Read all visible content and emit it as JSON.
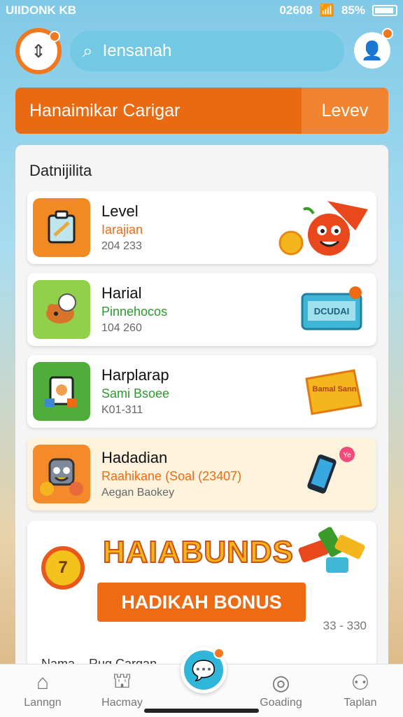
{
  "status": {
    "left": "UIIDONK KB",
    "time": "02608",
    "battery": "85%"
  },
  "search": {
    "placeholder": "Iensanah"
  },
  "banner": {
    "title": "Hanaimikar Carigar",
    "level_label": "Levev"
  },
  "panel": {
    "title": "Datnijilita"
  },
  "cards": [
    {
      "name": "Level",
      "sub": "Iarajian",
      "meta": "204 233",
      "sub_color": "#f06a14",
      "thumb_color": "#f28a24",
      "icon": "clipboard-icon",
      "art": "tomato-mascot"
    },
    {
      "name": "Harial",
      "sub": "Pinnehocos",
      "meta": "104 260",
      "sub_color": "#2b9a2b",
      "thumb_color": "#92cf4a",
      "icon": "bear-icon",
      "art": "ticket"
    },
    {
      "name": "Harplarap",
      "sub": "Sami Bsoee",
      "meta": "K01-311",
      "sub_color": "#2b9a2b",
      "thumb_color": "#4fae3a",
      "icon": "puzzle-icon",
      "art": "bamal-sann-tag"
    },
    {
      "name": "Hadadian",
      "sub": "Raahikane (Soal (23407)",
      "meta": "Aegan Baokey",
      "sub_color": "#f06a14",
      "thumb_color": "#f48a2a",
      "icon": "robot-icon",
      "art": "phone"
    }
  ],
  "card_art": {
    "ticket_text": "DCUDAI",
    "tag_text": "Bamal Sann",
    "phone_badge": "Ye"
  },
  "bonus": {
    "coin": "7",
    "headline": "HAIABUNDS",
    "button": "HADIKAH BONUS",
    "count": "33 - 330",
    "peek": "Nama... Rug Cargan"
  },
  "nav": [
    {
      "label": "Lanngn",
      "icon": "home-icon"
    },
    {
      "label": "Hacmay",
      "icon": "house-flag-icon"
    },
    {
      "label": "Goading",
      "icon": "target-icon"
    },
    {
      "label": "Taplan",
      "icon": "profile-icon"
    }
  ],
  "colors": {
    "accent": "#f06a14",
    "sky": "#7fc9e8",
    "fab": "#2fb6d8"
  }
}
